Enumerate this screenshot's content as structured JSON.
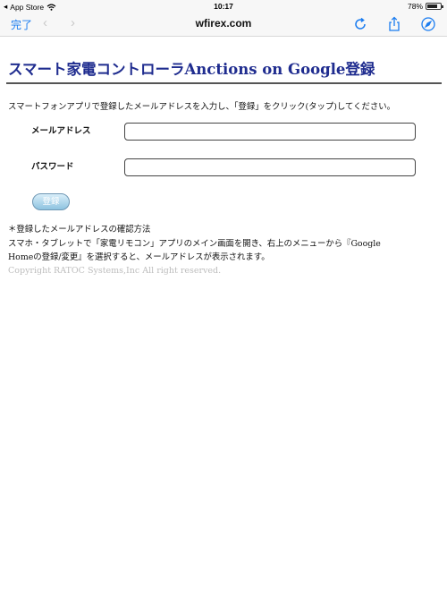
{
  "status_bar": {
    "back_app": "App Store",
    "time": "10:17",
    "battery_text": "78%",
    "battery_level": 0.78
  },
  "nav": {
    "done_label": "完了",
    "back_glyph": "‹",
    "forward_glyph": "›",
    "url": "wfirex.com",
    "accent_color": "#1a7cf0",
    "icons": [
      "reload-icon",
      "share-icon",
      "compass-icon"
    ]
  },
  "page": {
    "title": "スマート家電コントローラAnctions on Google登録",
    "title_color": "#1f2c8f",
    "intro": "スマートフォンアプリで登録したメールアドレスを入力し、「登録」をクリック(タップ)してください。",
    "email_label": "メールアドレス",
    "email_value": "",
    "password_label": "パスワード",
    "password_value": "",
    "submit_label": "登録",
    "note_heading": "＊登録したメールアドレスの確認方法",
    "note_line1": "スマホ・タブレットで「家電リモコン」アプリのメイン画面を開き、右上のメニューから『Google",
    "note_line2": "Homeの登録/変更』を選択すると、メールアドレスが表示されます。",
    "copyright": "Copyright RATOC Systems,Inc All right reserved."
  }
}
